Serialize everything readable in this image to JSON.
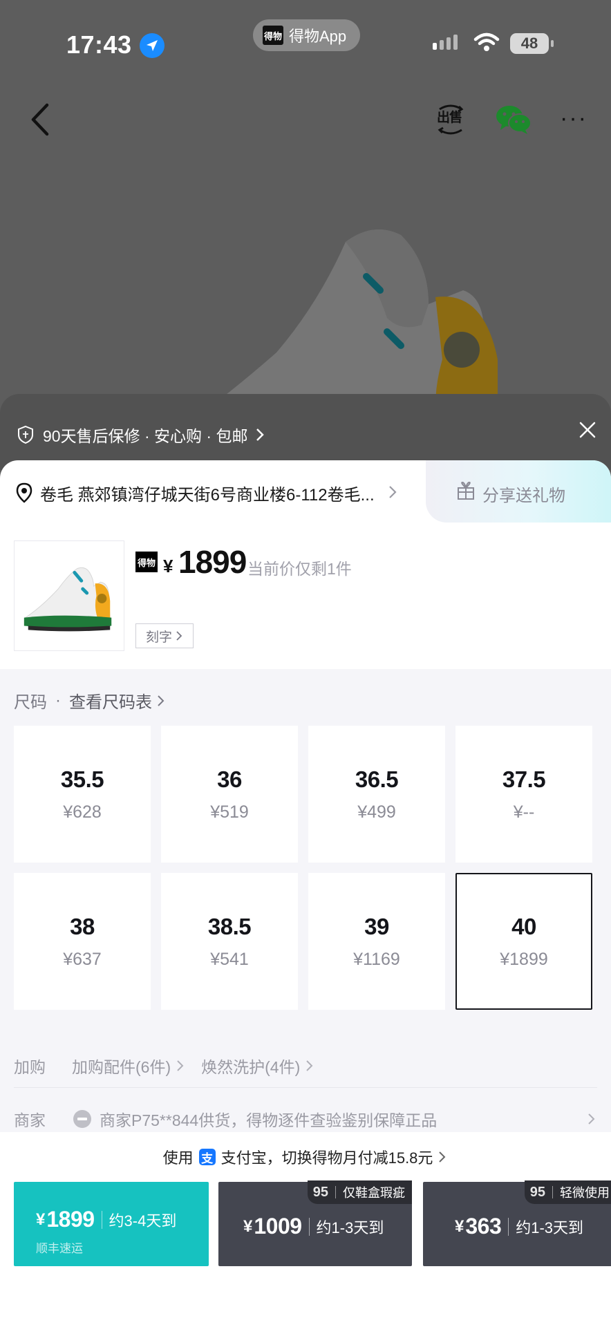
{
  "status_bar": {
    "time": "17:43",
    "app_pill": "得物App",
    "app_logo_text": "得物",
    "battery": "48"
  },
  "nav": {
    "sell_label": "出售"
  },
  "banner": {
    "text": "90天售后保修 · 安心购 · 包邮"
  },
  "address": {
    "text": "卷毛 燕郊镇湾仔城天街6号商业楼6-112卷毛...",
    "gift_label": "分享送礼物"
  },
  "product": {
    "logo_text": "得物",
    "currency": "¥",
    "price": "1899",
    "note": "当前价仅剩1件",
    "engrave_label": "刻字"
  },
  "size_section": {
    "label": "尺码",
    "dot": "·",
    "chart_link": "查看尺码表"
  },
  "sizes": [
    {
      "size": "35.5",
      "price": "¥628",
      "selected": false
    },
    {
      "size": "36",
      "price": "¥519",
      "selected": false
    },
    {
      "size": "36.5",
      "price": "¥499",
      "selected": false
    },
    {
      "size": "37.5",
      "price": "¥--",
      "selected": false
    },
    {
      "size": "38",
      "price": "¥637",
      "selected": false
    },
    {
      "size": "38.5",
      "price": "¥541",
      "selected": false
    },
    {
      "size": "39",
      "price": "¥1169",
      "selected": false
    },
    {
      "size": "40",
      "price": "¥1899",
      "selected": true
    }
  ],
  "addons": {
    "label": "加购",
    "item1": "加购配件(6件)",
    "item2": "焕然洗护(4件)"
  },
  "merchant": {
    "label": "商家",
    "text": "商家P75**844供货，得物逐件查验鉴别保障正品"
  },
  "payment": {
    "prefix": "使用",
    "alipay_icon": "支",
    "text": "支付宝，切换得物月付减15.8元"
  },
  "buy_options": [
    {
      "currency": "¥",
      "price": "1899",
      "eta": "约3-4天到",
      "sub": "顺丰速运"
    },
    {
      "currency": "¥",
      "price": "1009",
      "eta": "约1-3天到",
      "tag_num": "95",
      "tag_text": "仅鞋盒瑕疵"
    },
    {
      "currency": "¥",
      "price": "363",
      "eta": "约1-3天到",
      "tag_num": "95",
      "tag_text": "轻微使用"
    }
  ],
  "colors": {
    "accent": "#16c2c0",
    "dark_button": "#444650",
    "selected_border": "#14151a"
  }
}
